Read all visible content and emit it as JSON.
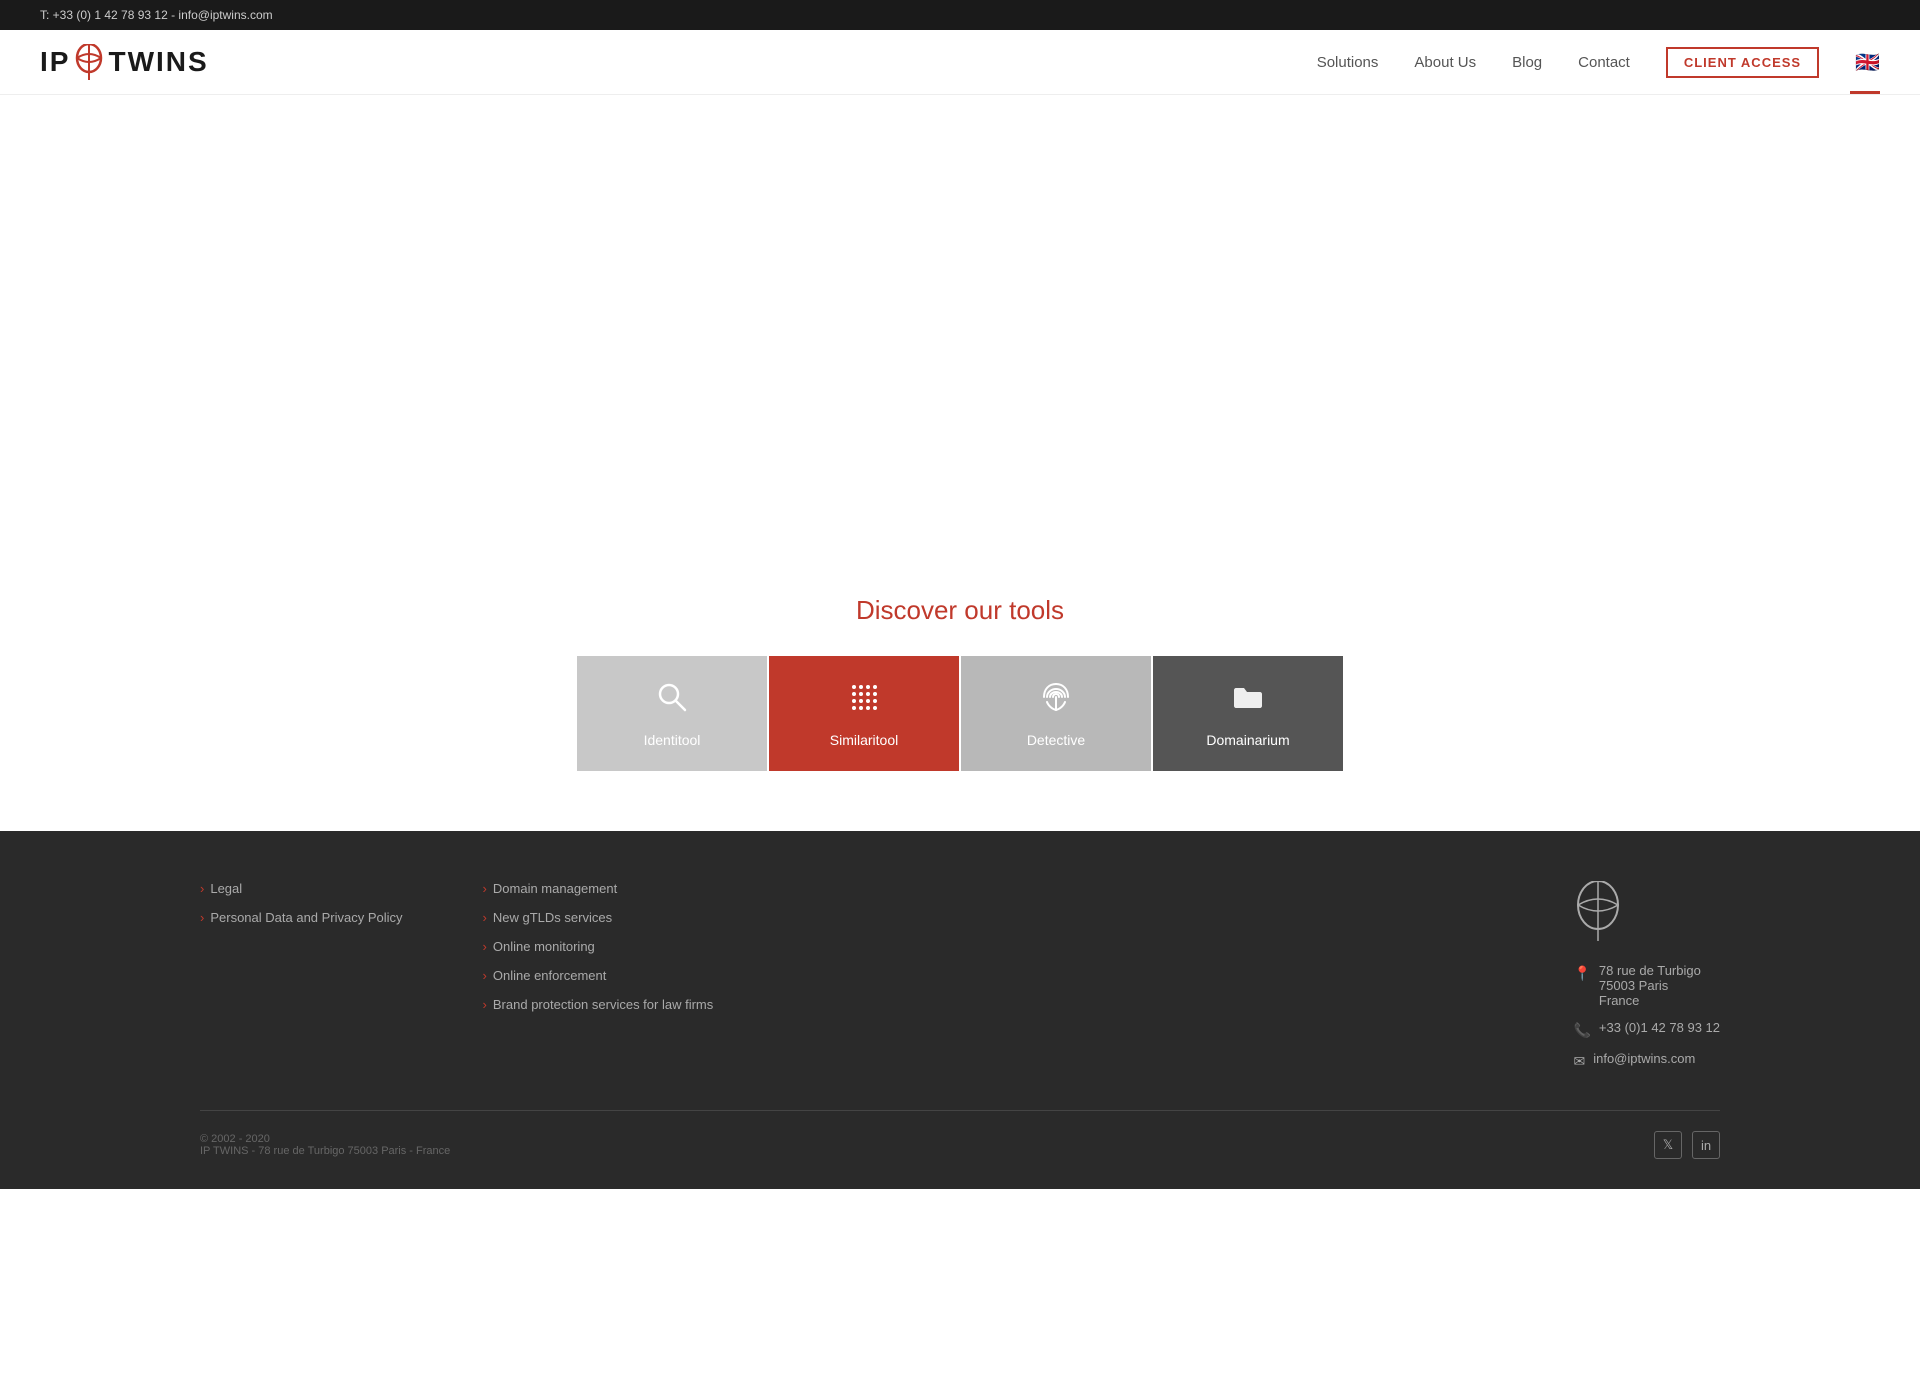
{
  "topbar": {
    "contact": "T: +33 (0) 1 42 78 93 12 - info@iptwins.com"
  },
  "header": {
    "logo_text_left": "IP",
    "logo_text_right": "TWINS",
    "nav": {
      "solutions": "Solutions",
      "about_us": "About Us",
      "blog": "Blog",
      "contact": "Contact",
      "client_access": "CLIENT ACCESS",
      "flag": "🇬🇧"
    }
  },
  "tools_section": {
    "title": "Discover our tools",
    "tools": [
      {
        "id": "identitool",
        "label": "Identitool",
        "icon": "🔍"
      },
      {
        "id": "similaritool",
        "label": "Similaritool",
        "icon": "⠿"
      },
      {
        "id": "detective",
        "label": "Detective",
        "icon": "👆"
      },
      {
        "id": "domainarium",
        "label": "Domainarium",
        "icon": "📁"
      }
    ]
  },
  "footer": {
    "col1": {
      "links": [
        {
          "label": "Legal",
          "href": "#"
        },
        {
          "label": "Personal Data and Privacy Policy",
          "href": "#"
        }
      ]
    },
    "col2": {
      "links": [
        {
          "label": "Domain management",
          "href": "#"
        },
        {
          "label": "New gTLDs services",
          "href": "#"
        },
        {
          "label": "Online monitoring",
          "href": "#"
        },
        {
          "label": "Online enforcement",
          "href": "#"
        },
        {
          "label": "Brand protection services for law firms",
          "href": "#"
        }
      ]
    },
    "contact": {
      "address": "78 rue de Turbigo\n75003 Paris\nFrance",
      "phone": "+33 (0)1 42 78 93 12",
      "email": "info@iptwins.com"
    },
    "bottom": {
      "copy": "© 2002 - 2020\nIP TWINS - 78 rue de Turbigo 75003 Paris - France"
    }
  }
}
